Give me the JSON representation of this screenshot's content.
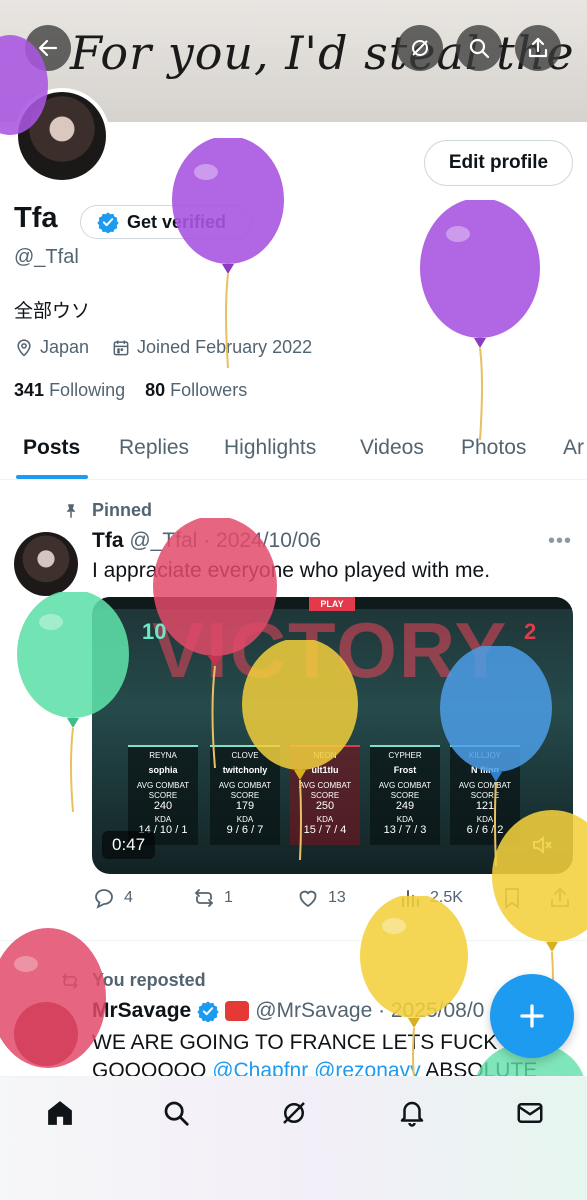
{
  "banner": {
    "text": "For you, I'd steal the stars."
  },
  "header_buttons": [
    {
      "name": "back",
      "icon": "arrow-left-icon"
    },
    {
      "name": "grok",
      "icon": "grok-icon"
    },
    {
      "name": "search",
      "icon": "search-icon"
    },
    {
      "name": "share",
      "icon": "share-icon"
    }
  ],
  "profile": {
    "edit_label": "Edit profile",
    "name": "Tfa",
    "get_verified_label": "Get verified",
    "handle": "@_Tfal",
    "bio": "全部ウソ",
    "location": "Japan",
    "joined": "Joined February 2022",
    "following_count": "341",
    "following_label": "Following",
    "followers_count": "80",
    "followers_label": "Followers"
  },
  "tabs": [
    "Posts",
    "Replies",
    "Highlights",
    "Videos",
    "Photos",
    "Ar"
  ],
  "post1": {
    "pinned_label": "Pinned",
    "name": "Tfa",
    "meta": "@_Tfal · 2024/10/06",
    "text": "I appraciate everyone who played with me.",
    "media": {
      "top_label": "PLAY",
      "title": "VICTORY",
      "score_left": "10",
      "score_right": "2",
      "duration": "0:47",
      "players": [
        {
          "agent": "REYNA",
          "name": "sophia",
          "acs": "240",
          "kda": "14 / 10 / 1"
        },
        {
          "agent": "CLOVE",
          "name": "twitchonly",
          "acs": "179",
          "kda": "9 / 6 / 7"
        },
        {
          "agent": "NEON",
          "name": "ult1tlu",
          "acs": "250",
          "kda": "15 / 7 / 4"
        },
        {
          "agent": "CYPHER",
          "name": "Frost",
          "acs": "249",
          "kda": "13 / 7 / 3"
        },
        {
          "agent": "KILLJOY",
          "name": "N fling",
          "acs": "121",
          "kda": "6 / 6 / 2"
        }
      ],
      "acs_label": "AVG COMBAT SCORE",
      "kda_label": "KDA"
    },
    "replies": "4",
    "reposts": "1",
    "likes": "13",
    "views": "2.5K"
  },
  "post2": {
    "repost_label": "You reposted",
    "name": "MrSavage",
    "meta": "@MrSavage · 2025/08/0",
    "text_main": "WE ARE GOING TO FRANCE LETS FUCK GOOOOOO ",
    "mention1": "@Chapfnr",
    "mention2": "@rezonavy",
    "text_tail": " ABSOLUTE"
  },
  "bottom_nav": [
    {
      "name": "home",
      "icon": "home-icon"
    },
    {
      "name": "search",
      "icon": "search-icon"
    },
    {
      "name": "grok",
      "icon": "grok-icon"
    },
    {
      "name": "notifications",
      "icon": "bell-icon"
    },
    {
      "name": "messages",
      "icon": "mail-icon"
    }
  ],
  "colors": {
    "accent": "#1d9bf0",
    "text": "#0f1419",
    "muted": "#536471",
    "balloon_purple": "#a855e0",
    "balloon_red": "#e24a6a",
    "balloon_green": "#5fe0a8",
    "balloon_yellow": "#f2cf3c",
    "balloon_blue": "#4c9ee8"
  }
}
